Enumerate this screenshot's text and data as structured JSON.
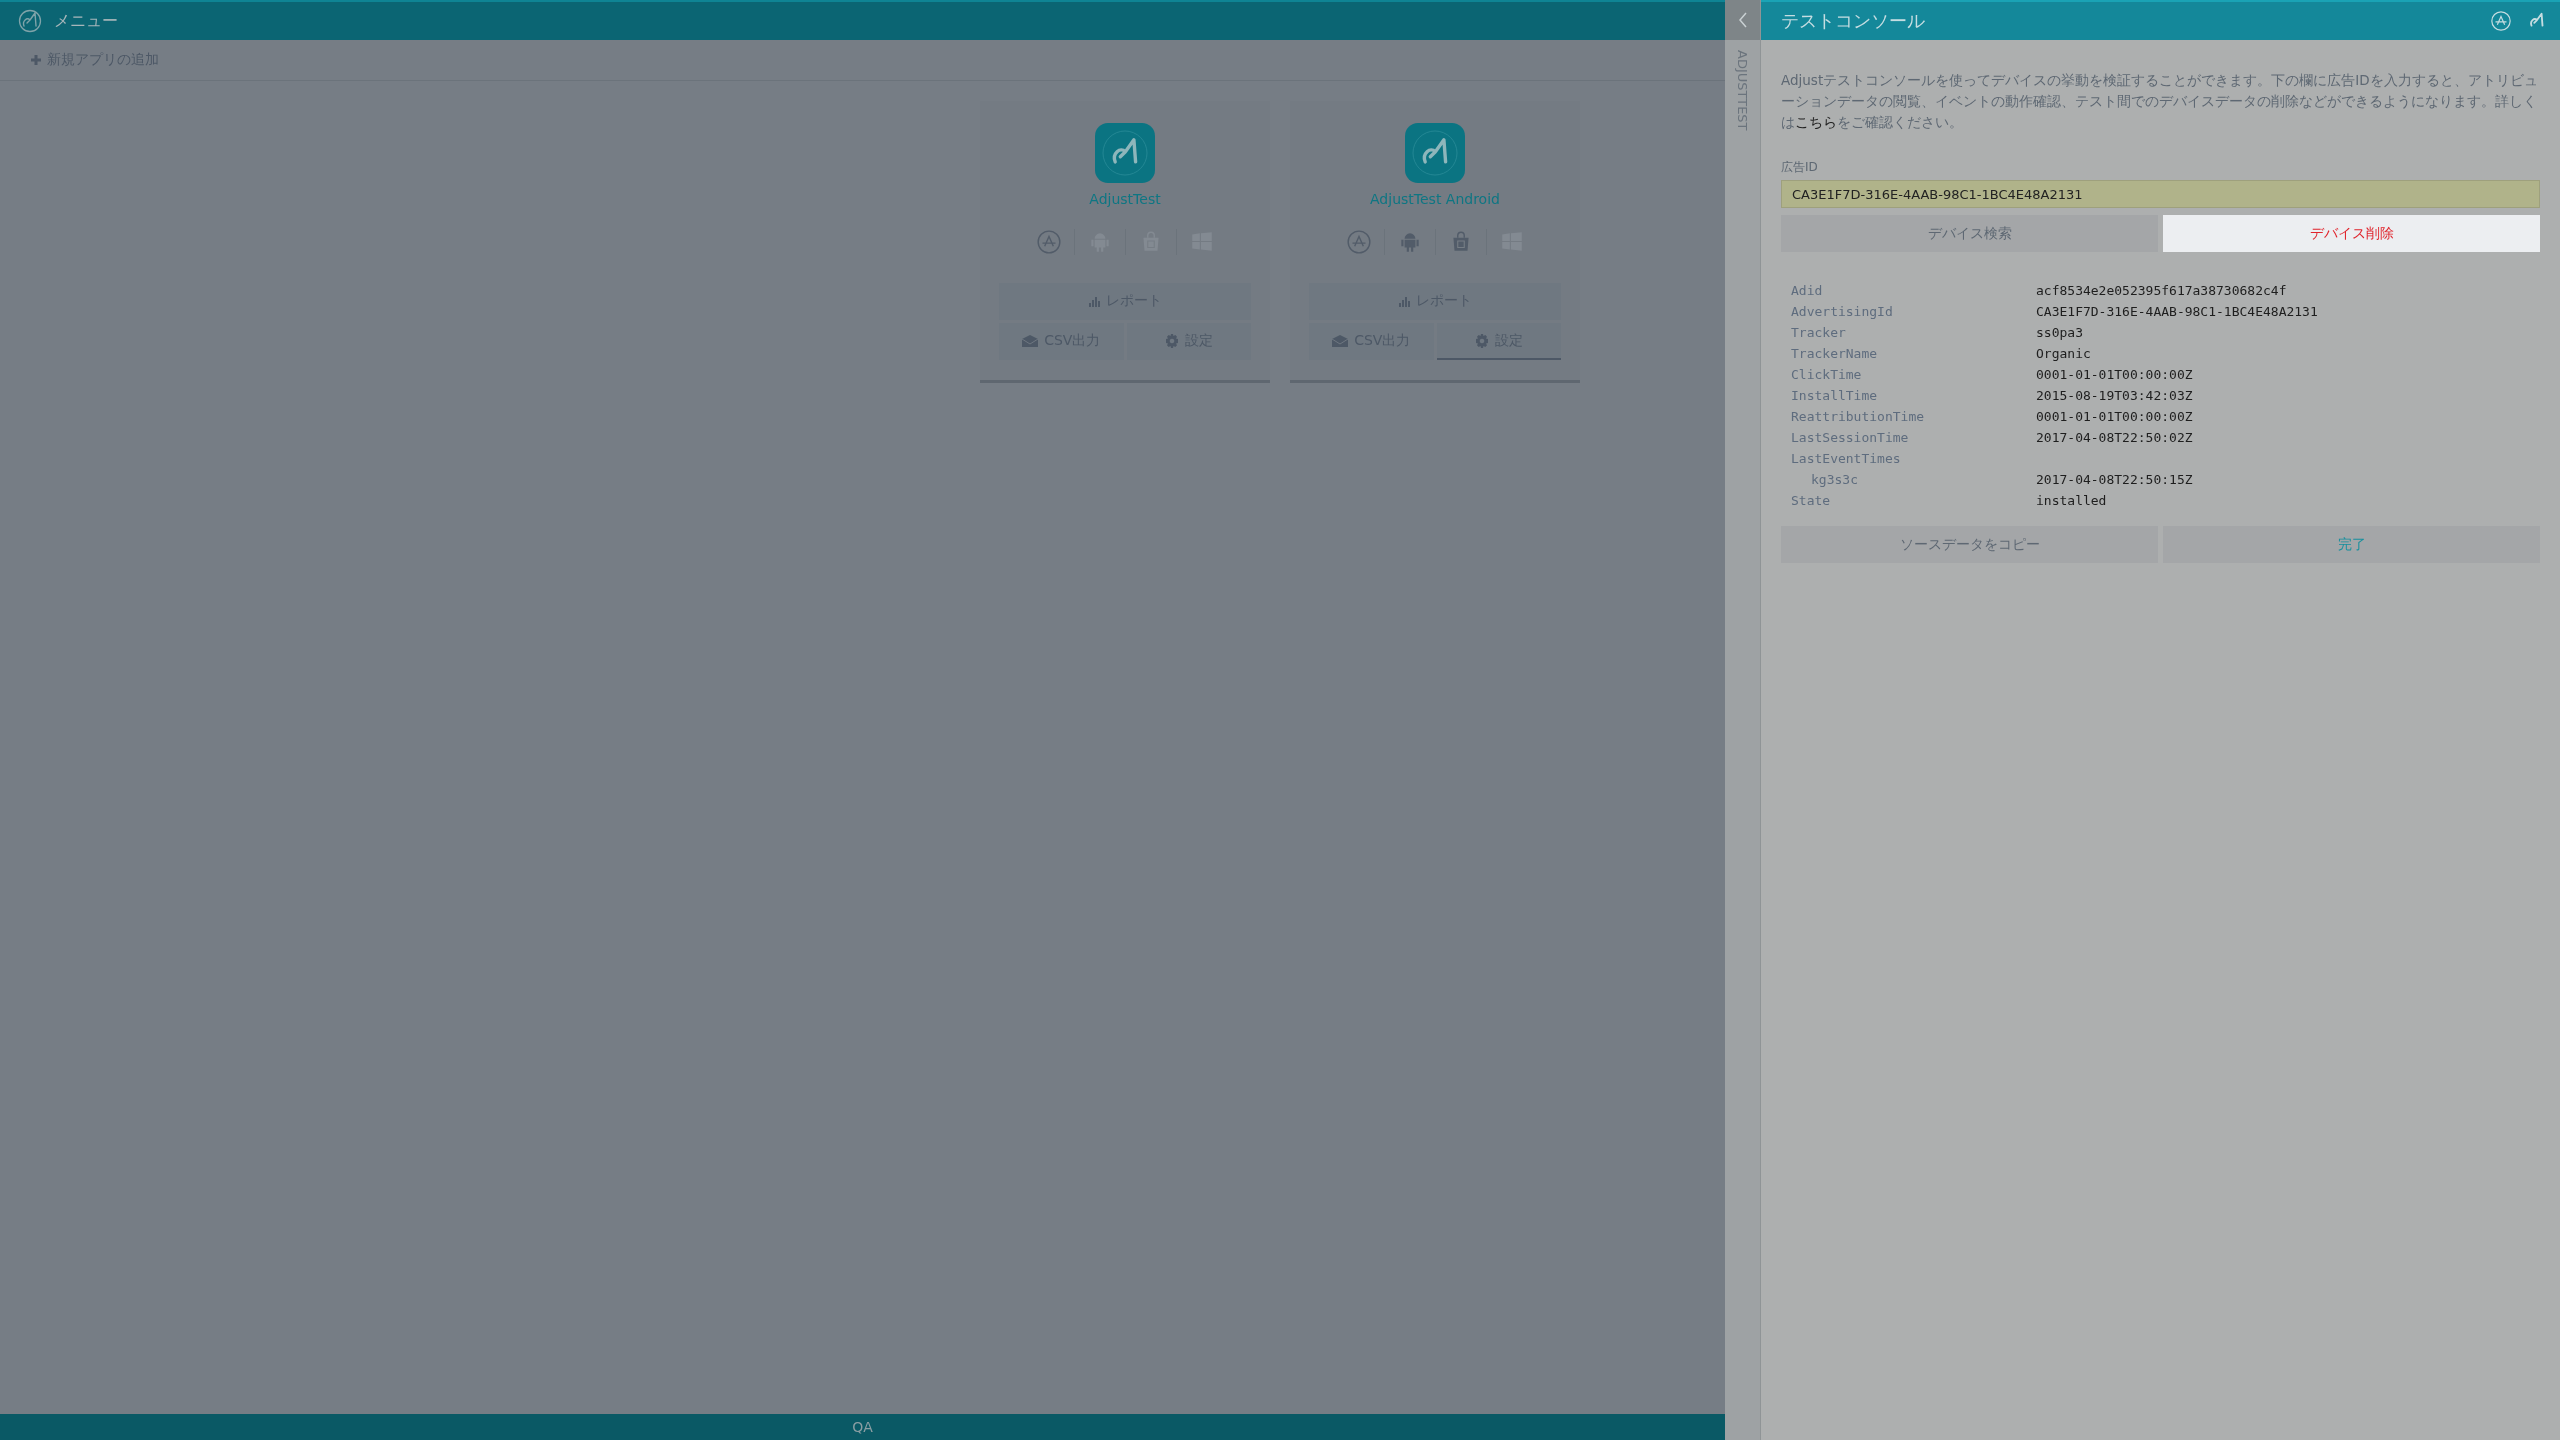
{
  "top_bar": {
    "title": "メニュー"
  },
  "toolbar": {
    "add_app": "新規アプリの追加"
  },
  "apps": [
    {
      "name": "AdjustTest",
      "platforms": [
        {
          "kind": "appstore",
          "enabled": true
        },
        {
          "kind": "android",
          "enabled": false
        },
        {
          "kind": "store",
          "enabled": false
        },
        {
          "kind": "windows",
          "enabled": false
        }
      ],
      "report": "レポート",
      "csv": "CSV出力",
      "settings": {
        "label": "設定",
        "selected": false
      }
    },
    {
      "name": "AdjustTest Android",
      "platforms": [
        {
          "kind": "appstore",
          "enabled": true
        },
        {
          "kind": "android",
          "enabled": true
        },
        {
          "kind": "store",
          "enabled": true
        },
        {
          "kind": "windows",
          "enabled": false
        }
      ],
      "report": "レポート",
      "csv": "CSV出力",
      "settings": {
        "label": "設定",
        "selected": true
      }
    }
  ],
  "status_bar": {
    "text": "QA"
  },
  "side_tab": {
    "label": "ADJUSTTEST"
  },
  "console": {
    "title": "テストコンソール",
    "description": {
      "before": "Adjustテストコンソールを使ってデバイスの挙動を検証することができます。下の欄に広告IDを入力すると、アトリビューションデータの閲覧、イベントの動作確認、テスト間でのデバイスデータの削除などができるようになります。詳しくは",
      "link": "こちら",
      "after": "をご確認ください。"
    },
    "ad_id": {
      "label": "広告ID",
      "value": "CA3E1F7D-316E-4AAB-98C1-1BC4E48A2131"
    },
    "actions": [
      {
        "label": "デバイス検索",
        "selected": false
      },
      {
        "label": "デバイス削除",
        "selected": true
      }
    ],
    "rows": [
      {
        "key": "Adid",
        "value": "acf8534e2e052395f617a38730682c4f"
      },
      {
        "key": "AdvertisingId",
        "value": "CA3E1F7D-316E-4AAB-98C1-1BC4E48A2131"
      },
      {
        "key": "Tracker",
        "value": "ss0pa3"
      },
      {
        "key": "TrackerName",
        "value": "Organic"
      },
      {
        "key": "ClickTime",
        "value": "0001-01-01T00:00:00Z"
      },
      {
        "key": "InstallTime",
        "value": "2015-08-19T03:42:03Z"
      },
      {
        "key": "ReattributionTime",
        "value": "0001-01-01T00:00:00Z"
      },
      {
        "key": "LastSessionTime",
        "value": "2017-04-08T22:50:02Z"
      },
      {
        "key": "LastEventTimes",
        "children": [
          {
            "key": "kg3s3c",
            "value": "2017-04-08T22:50:15Z"
          }
        ]
      },
      {
        "key": "State",
        "value": "installed"
      }
    ],
    "footer_buttons": [
      {
        "label": "ソースデータをコピー",
        "kind": "secondary"
      },
      {
        "label": "完了",
        "kind": "primary"
      }
    ]
  }
}
